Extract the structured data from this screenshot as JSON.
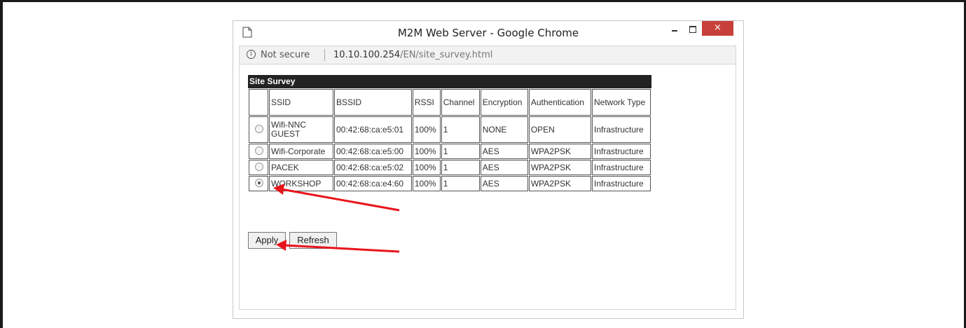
{
  "window": {
    "title": "M2M Web Server - Google Chrome",
    "close_glyph": "×"
  },
  "address_bar": {
    "security_label": "Not secure",
    "url_host": "10.10.100.254",
    "url_path": "/EN/site_survey.html"
  },
  "survey": {
    "title": "Site Survey",
    "columns": [
      "",
      "SSID",
      "BSSID",
      "RSSI",
      "Channel",
      "Encryption",
      "Authentication",
      "Network Type"
    ],
    "rows": [
      {
        "selected": false,
        "ssid": "Wifi-NNC GUEST",
        "bssid": "00:42:68:ca:e5:01",
        "rssi": "100%",
        "channel": "1",
        "encryption": "NONE",
        "authentication": "OPEN",
        "network_type": "Infrastructure"
      },
      {
        "selected": false,
        "ssid": "Wifi-Corporate",
        "bssid": "00:42:68:ca:e5:00",
        "rssi": "100%",
        "channel": "1",
        "encryption": "AES",
        "authentication": "WPA2PSK",
        "network_type": "Infrastructure"
      },
      {
        "selected": false,
        "ssid": "PACEK",
        "bssid": "00:42:68:ca:e5:02",
        "rssi": "100%",
        "channel": "1",
        "encryption": "AES",
        "authentication": "WPA2PSK",
        "network_type": "Infrastructure"
      },
      {
        "selected": true,
        "ssid": "WORKSHOP",
        "bssid": "00:42:68:ca:e4:60",
        "rssi": "100%",
        "channel": "1",
        "encryption": "AES",
        "authentication": "WPA2PSK",
        "network_type": "Infrastructure"
      }
    ]
  },
  "buttons": {
    "apply": "Apply",
    "refresh": "Refresh"
  },
  "annotation": {
    "arrow_color": "#e8141b"
  }
}
